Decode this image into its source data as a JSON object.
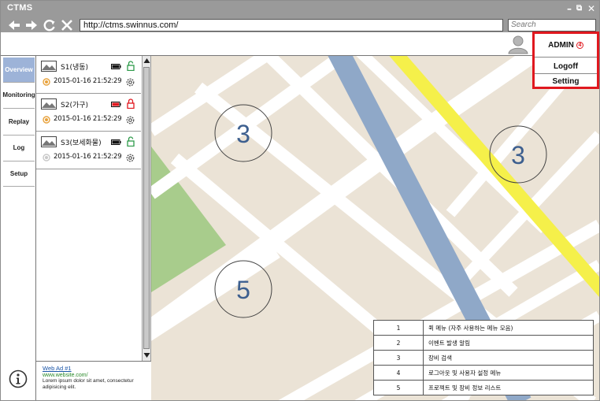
{
  "app": {
    "title": "CTMS"
  },
  "window_controls": {
    "minimize": "–",
    "restore": "⧉",
    "close": "✕"
  },
  "navbar": {
    "url": "http://ctms.swinnus.com/",
    "search_placeholder": "Search"
  },
  "admin_menu": {
    "user": "ADMIN",
    "badge": "4",
    "logoff": "Logoff",
    "setting": "Setting"
  },
  "tabs": [
    {
      "label": "Overview",
      "active": true
    },
    {
      "label": "Monitoring",
      "active": false
    },
    {
      "label": "Replay",
      "active": false
    },
    {
      "label": "Log",
      "active": false
    },
    {
      "label": "Setup",
      "active": false
    }
  ],
  "devices": [
    {
      "name": "S1(냉동)",
      "timestamp": "2015-01-16 21:52:29",
      "battery": "full",
      "lock": "unlocked",
      "status_color": "#e8a23c"
    },
    {
      "name": "S2(가구)",
      "timestamp": "2015-01-16 21:52:29",
      "battery": "low",
      "lock": "locked",
      "status_color": "#e8a23c"
    },
    {
      "name": "S3(보세화물)",
      "timestamp": "2015-01-16 21:52:29",
      "battery": "full",
      "lock": "unlocked",
      "status_color": "#c8c8c8"
    }
  ],
  "ad": {
    "title": "Web Ad #1",
    "url": "www.website.com/",
    "text": "Lorem ipsum dolor sit amet, consectetur adipisicing elit."
  },
  "map": {
    "clusters": [
      {
        "count": "3"
      },
      {
        "count": "3"
      },
      {
        "count": "5"
      }
    ]
  },
  "legend": [
    {
      "num": "1",
      "text": "퀵 메뉴 (자주 사용하는 메뉴 모음)"
    },
    {
      "num": "2",
      "text": "이벤트 발생 알림"
    },
    {
      "num": "3",
      "text": "장비 검색"
    },
    {
      "num": "4",
      "text": "로그아웃 및 사용자 설정 메뉴"
    },
    {
      "num": "5",
      "text": "프로젝트 및 장비 정보 리스트"
    }
  ],
  "colors": {
    "chrome": "#9a9a9a",
    "active_tab": "#9db3d8",
    "highlight": "#e0181f",
    "map_bg": "#ebe3d6",
    "road": "#ffffff",
    "river": "#8fa8c8",
    "highway": "#f5f04a",
    "park": "#a8cc8c",
    "cluster_text": "#3d5f8f"
  }
}
